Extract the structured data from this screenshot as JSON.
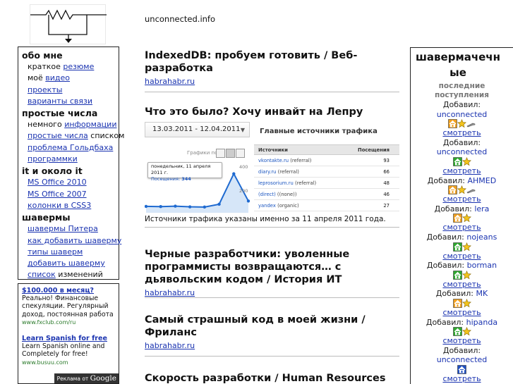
{
  "site": {
    "name": "unconnected.info"
  },
  "sidebar": {
    "sections": [
      {
        "title": "обо мне",
        "items": [
          {
            "before": "краткое ",
            "link": "резюме",
            "after": ""
          },
          {
            "before": "моё ",
            "link": "видео",
            "after": ""
          },
          {
            "before": "",
            "link": "проекты",
            "after": ""
          },
          {
            "before": "",
            "link": "варианты связи",
            "after": ""
          }
        ]
      },
      {
        "title": "простые числа",
        "items": [
          {
            "before": "немного ",
            "link": "информации",
            "after": ""
          },
          {
            "before": "",
            "link": "простые числа",
            "after": " списком"
          },
          {
            "before": "",
            "link": "проблема Гольдбаха",
            "after": ""
          },
          {
            "before": "",
            "link": "программки",
            "after": ""
          }
        ]
      },
      {
        "title": "it и около it",
        "items": [
          {
            "before": "",
            "link": "MS Office 2010",
            "after": ""
          },
          {
            "before": "",
            "link": "MS Office 2007",
            "after": ""
          },
          {
            "before": "",
            "link": "колонки в CSS3",
            "after": ""
          }
        ]
      },
      {
        "title": "шавермы",
        "items": [
          {
            "before": "",
            "link": "шавермы Питера",
            "after": ""
          },
          {
            "before": "",
            "link": "как добавить шаверму",
            "after": ""
          },
          {
            "before": "",
            "link": "типы шаверм",
            "after": ""
          },
          {
            "before": "",
            "link": "добавить шаверму",
            "after": ""
          },
          {
            "before": "",
            "link": "список",
            "after": " изменений"
          }
        ]
      }
    ]
  },
  "ads": {
    "items": [
      {
        "title": "$100.000 в месяц?",
        "body": "Реально! Финансовые спекуляции. Регулярный доход, постоянная работа",
        "url": "www.fxclub.com/ru"
      },
      {
        "title": "Learn Spanish for free",
        "body": "Learn Spanish online and Completely for free!",
        "url": "www.busuu.com"
      }
    ],
    "footer_prefix": "Реклама от",
    "footer_brand": "Google"
  },
  "posts": [
    {
      "title": "IndexedDB: пробуем готовить / Веб-разработка",
      "source": "habrahabr.ru"
    },
    {
      "title": "Что это было? Хочу инвайт на Лепру",
      "caption": "Источники трафика указаны именно за 11 апреля 2011 года."
    },
    {
      "title": "Черные разработчики: уволенные программисты возвращаются… с дьявольским кодом / История ИТ",
      "source": "habrahabr.ru"
    },
    {
      "title": "Самый страшный код в моей жизни / Фриланс",
      "source": "habrahabr.ru"
    },
    {
      "title": "Скорость разработки / Human Resources",
      "source": ""
    }
  ],
  "analytics": {
    "date_range": "13.03.2011 - 12.04.2011",
    "graph_label": "Графики по:",
    "tooltip_date": "понедельник, 11 апреля 2011 г.",
    "tooltip_metric": "Посещения:",
    "tooltip_value": "344",
    "y_ticks": [
      "400",
      "200"
    ],
    "table_title": "Главные источники трафика",
    "col_source": "Источники",
    "col_visits": "Посещения",
    "rows": [
      {
        "source": "vkontakte.ru",
        "kind": "(referral)",
        "visits": "93"
      },
      {
        "source": "diary.ru",
        "kind": "(referral)",
        "visits": "66"
      },
      {
        "source": "leprosorium.ru",
        "kind": "(referral)",
        "visits": "48"
      },
      {
        "source": "(direct)",
        "kind": "((none))",
        "visits": "46"
      },
      {
        "source": "yandex",
        "kind": "(organic)",
        "visits": "27"
      }
    ],
    "series": [
      40,
      38,
      42,
      36,
      34,
      60,
      344,
      90
    ]
  },
  "rbar": {
    "title": "шавермачечные",
    "subtitle": "последние поступления",
    "added_label": "Добавил:",
    "view_label": "смотреть",
    "entries": [
      {
        "user": "unconnected",
        "icons": [
          "house-icon",
          "star-icon",
          "knife-icon"
        ]
      },
      {
        "user": "unconnected",
        "icons": [
          "house-icon",
          "star-icon"
        ]
      },
      {
        "user": "AHMED",
        "icons": [
          "house-icon",
          "star-icon",
          "knife-icon"
        ]
      },
      {
        "user": "lera",
        "icons": [
          "house-icon",
          "star-icon"
        ]
      },
      {
        "user": "nojeans",
        "icons": [
          "house-icon",
          "star-icon"
        ]
      },
      {
        "user": "borman",
        "icons": [
          "house-icon",
          "star-icon"
        ]
      },
      {
        "user": "MK",
        "icons": [
          "house-icon",
          "star-icon"
        ]
      },
      {
        "user": "hipanda",
        "icons": [
          "house-icon",
          "star-icon"
        ]
      },
      {
        "user": "unconnected",
        "icons": [
          "house-icon"
        ]
      }
    ]
  },
  "colors": {
    "link": "#1a33b0",
    "house_orange": "#f0a020",
    "house_green": "#2ea82e",
    "house_blue": "#2050c0"
  }
}
